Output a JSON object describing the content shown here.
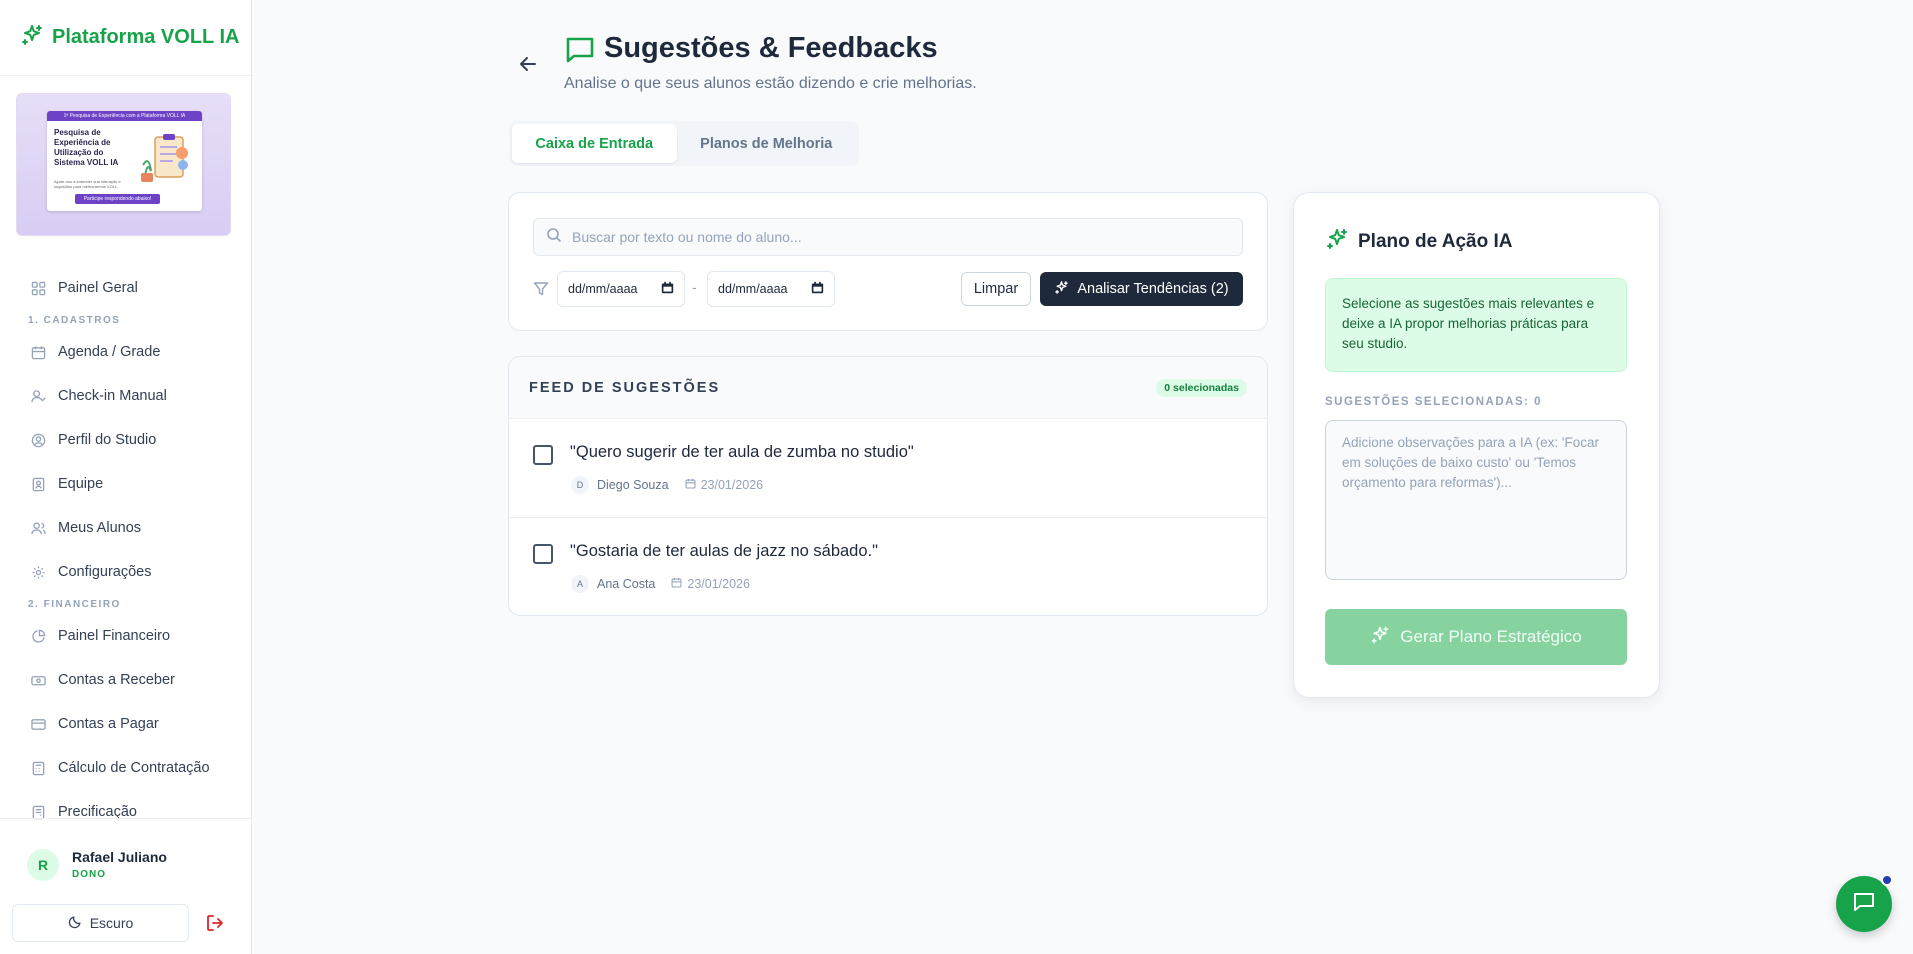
{
  "brand": {
    "name": "Plataforma VOLL IA"
  },
  "banner": {
    "top_text": "1ª Pesquisa de Experiência com a Plataforma VOLL IA",
    "title": "Pesquisa de Experiência de Utilização do Sistema VOLL IA",
    "subtitle": "Ajude-nos a entender sua interação e sugestões para melhorarmos VOLL.",
    "cta": "Participe respondendo abaixo!"
  },
  "sidebar": {
    "items": [
      {
        "label": "Painel Geral",
        "icon": "grid-icon"
      },
      {
        "section": "1. CADASTROS"
      },
      {
        "label": "Agenda / Grade",
        "icon": "calendar-icon"
      },
      {
        "label": "Check-in Manual",
        "icon": "user-check-icon"
      },
      {
        "label": "Perfil do Studio",
        "icon": "user-circle-icon"
      },
      {
        "label": "Equipe",
        "icon": "badge-icon"
      },
      {
        "label": "Meus Alunos",
        "icon": "users-icon"
      },
      {
        "label": "Configurações",
        "icon": "gear-icon"
      },
      {
        "section": "2. FINANCEIRO"
      },
      {
        "label": "Painel Financeiro",
        "icon": "pie-chart-icon"
      },
      {
        "label": "Contas a Receber",
        "icon": "banknote-icon"
      },
      {
        "label": "Contas a Pagar",
        "icon": "credit-card-icon"
      },
      {
        "label": "Cálculo de Contratação",
        "icon": "calculator-icon"
      },
      {
        "label": "Precificação",
        "icon": "tag-icon"
      }
    ]
  },
  "user": {
    "initial": "R",
    "name": "Rafael Juliano",
    "role": "DONO"
  },
  "theme_button": {
    "label": "Escuro"
  },
  "header": {
    "title": "Sugestões & Feedbacks",
    "subtitle": "Analise o que seus alunos estão dizendo e crie melhorias."
  },
  "tabs": [
    {
      "label": "Caixa de Entrada",
      "active": true
    },
    {
      "label": "Planos de Melhoria",
      "active": false
    }
  ],
  "filters": {
    "search_placeholder": "Buscar por texto ou nome do aluno...",
    "date_from": "dd/mm/aaaa",
    "date_to": "dd/mm/aaaa",
    "date_separator": "-",
    "clear_label": "Limpar",
    "analyze_label": "Analisar Tendências (2)"
  },
  "feed": {
    "title": "FEED DE SUGESTÕES",
    "selected_badge": "0 selecionadas",
    "items": [
      {
        "text": "\"Quero sugerir de ter aula de zumba no studio\"",
        "initial": "D",
        "author": "Diego Souza",
        "date": "23/01/2026"
      },
      {
        "text": "\"Gostaria de ter aulas de jazz no sábado.\"",
        "initial": "A",
        "author": "Ana Costa",
        "date": "23/01/2026"
      }
    ]
  },
  "ai_panel": {
    "title": "Plano de Ação IA",
    "info": "Selecione as sugestões mais relevantes e deixe a IA propor melhorias práticas para seu studio.",
    "selected_label": "SUGESTÕES SELECIONADAS: 0",
    "notes_placeholder": "Adicione observações para a IA (ex: 'Focar em soluções de baixo custo' ou 'Temos orçamento para reformas')...",
    "generate_label": "Gerar Plano Estratégico"
  },
  "colors": {
    "brand_green": "#16a34a",
    "dark_button": "#1e293b",
    "info_bg": "#dcfce7",
    "disabled_green": "#86d3a0",
    "logout_red": "#dc2626"
  }
}
